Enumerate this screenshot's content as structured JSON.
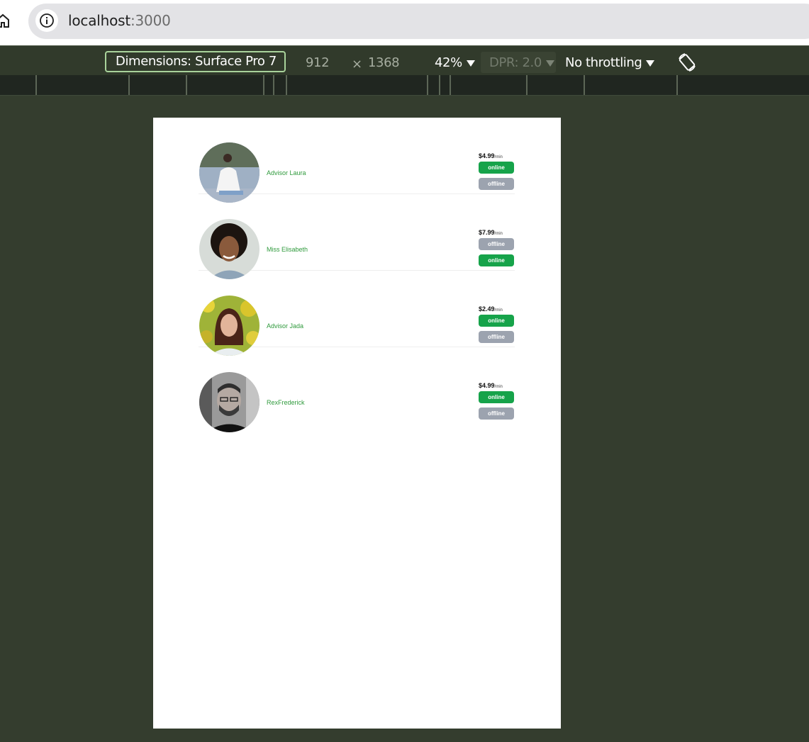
{
  "browser": {
    "url_host": "localhost",
    "url_port": ":3000"
  },
  "devtools": {
    "dimensions_label": "Dimensions: Surface Pro 7",
    "width": "912",
    "times": "×",
    "height": "1368",
    "zoom": "42%",
    "dpr": "DPR: 2.0",
    "throttling": "No throttling"
  },
  "advisors": [
    {
      "name": "Advisor Laura",
      "price": "$4.99",
      "per": "/min",
      "buttons": [
        "online",
        "offline"
      ]
    },
    {
      "name": "Miss Elisabeth",
      "price": "$7.99",
      "per": "/min",
      "buttons": [
        "offline",
        "online"
      ]
    },
    {
      "name": "Advisor Jada",
      "price": "$2.49",
      "per": "/min",
      "buttons": [
        "online",
        "offline"
      ]
    },
    {
      "name": "RexFrederick",
      "price": "$4.99",
      "per": "/min",
      "buttons": [
        "online",
        "offline"
      ]
    }
  ],
  "colors": {
    "online": "#16a34a",
    "offline": "#9ca3af",
    "name_text": "#2f9a3c",
    "devtools_bg": "#343d2e"
  }
}
